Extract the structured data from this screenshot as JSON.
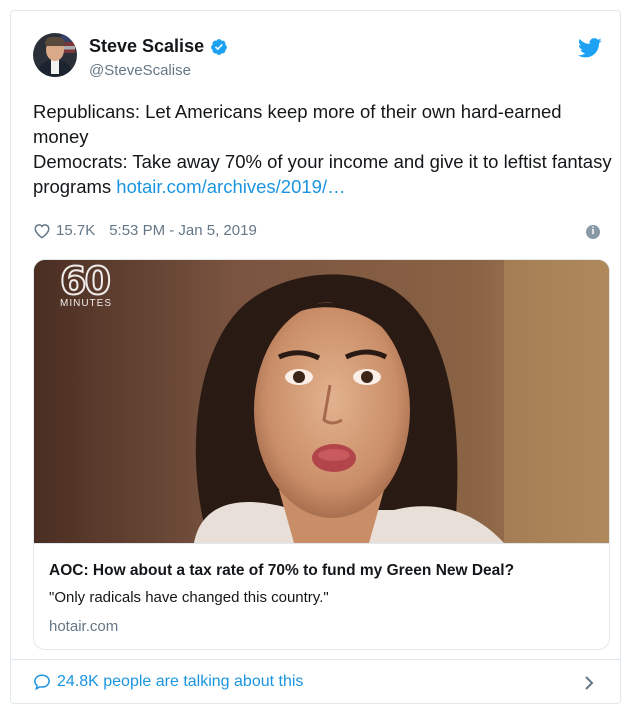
{
  "author": {
    "display_name": "Steve Scalise",
    "handle": "@SteveScalise",
    "verified": true
  },
  "tweet": {
    "text_line1": "Republicans: Let Americans keep more of their own hard-earned money",
    "text_line2": "Democrats: Take away 70% of your income and give it to leftist fantasy programs ",
    "link_text": "hotair.com/archives/2019/…",
    "likes": "15.7K",
    "timestamp": "5:53 PM - Jan 5, 2019"
  },
  "card": {
    "watermark_number": "60",
    "watermark_word": "MINUTES",
    "title": "AOC: How about a tax rate of 70% to fund my Green New Deal?",
    "description": "\"Only radicals have changed this country.\"",
    "domain": "hotair.com"
  },
  "footer": {
    "talking_text": "24.8K people are talking about this"
  },
  "icons": {
    "verified": "verified-badge-icon",
    "bird": "twitter-bird-icon",
    "heart": "heart-icon",
    "info": "info-icon",
    "bubble": "speech-bubble-icon",
    "chevron": "chevron-right-icon"
  },
  "colors": {
    "brand_blue": "#1b95e0",
    "secondary_text": "#657786",
    "border": "#e1e8ed"
  }
}
